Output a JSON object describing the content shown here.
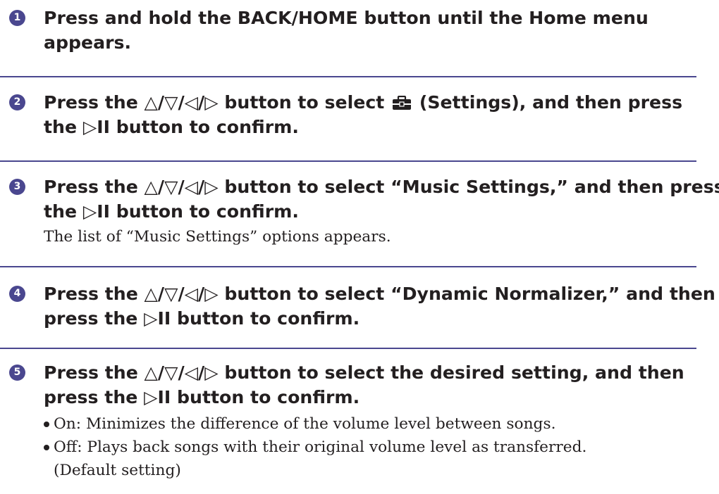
{
  "steps": [
    {
      "num": "1",
      "line1": "Press and hold the BACK/HOME button until the Home menu",
      "line2": "appears."
    },
    {
      "num": "2",
      "line1_a": "Press the △/▽/◁/▷ button to select",
      "line1_b": "(Settings), and then press",
      "line2": "the ▷II button to confirm.",
      "icon": "settings-toolbox-icon"
    },
    {
      "num": "3",
      "line1": "Press the △/▽/◁/▷ button to select “Music Settings,” and then press",
      "line2": "the ▷II button to confirm.",
      "note": "The list of “Music Settings” options appears."
    },
    {
      "num": "4",
      "line1": "Press the △/▽/◁/▷ button to select “Dynamic Normalizer,” and then",
      "line2": "press the ▷II button to confirm."
    },
    {
      "num": "5",
      "line1": "Press the △/▽/◁/▷ button to select the desired setting, and then",
      "line2": "press the ▷II button to confirm.",
      "bullets": [
        "On: Minimizes the difference of the volume level between songs.",
        "Off: Plays back songs with their original volume level as transferred."
      ],
      "bullet_cont": "(Default setting)"
    }
  ],
  "colors": {
    "accent": "#4a478f",
    "text": "#231f20"
  }
}
